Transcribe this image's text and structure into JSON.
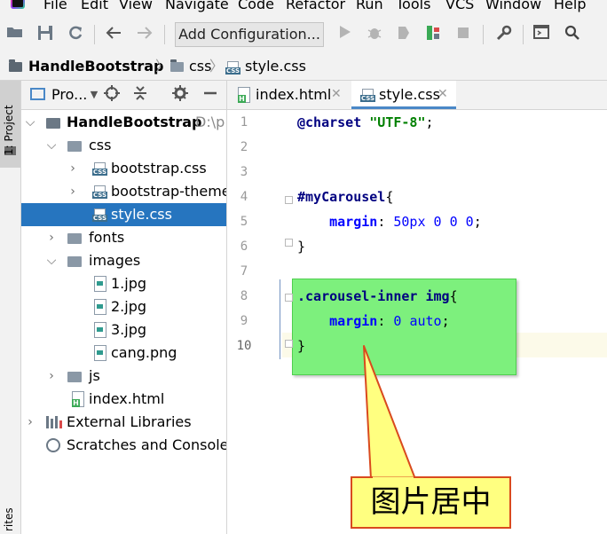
{
  "menu": {
    "items": [
      "File",
      "Edit",
      "View",
      "Navigate",
      "Code",
      "Refactor",
      "Run",
      "Tools",
      "VCS",
      "Window",
      "Help"
    ]
  },
  "toolbar": {
    "add_configuration_label": "Add Configuration..."
  },
  "breadcrumb": {
    "project": "HandleBootstrap",
    "folder": "css",
    "file": "style.css"
  },
  "left_stripe": {
    "project_tab": "1: Project",
    "bottom_tab": "rites"
  },
  "project_panel": {
    "title": "Pro...",
    "tree": [
      {
        "label": "HandleBootstrap",
        "hint": "D:\\p"
      },
      {
        "label": "css"
      },
      {
        "label": "bootstrap.css"
      },
      {
        "label": "bootstrap-theme"
      },
      {
        "label": "style.css"
      },
      {
        "label": "fonts"
      },
      {
        "label": "images"
      },
      {
        "label": "1.jpg"
      },
      {
        "label": "2.jpg"
      },
      {
        "label": "3.jpg"
      },
      {
        "label": "cang.png"
      },
      {
        "label": "js"
      },
      {
        "label": "index.html"
      },
      {
        "label": "External Libraries"
      },
      {
        "label": "Scratches and Consoles"
      }
    ]
  },
  "editor": {
    "tabs": [
      {
        "label": "index.html",
        "active": false
      },
      {
        "label": "style.css",
        "active": true
      }
    ],
    "line_numbers": [
      "1",
      "2",
      "3",
      "4",
      "5",
      "6",
      "7",
      "8",
      "9",
      "10"
    ],
    "code": {
      "l1_kw": "@charset",
      "l1_str": "\"UTF-8\"",
      "l1_end": ";",
      "l4_sel": "#myCarousel",
      "l4_brace": "{",
      "l5_prop": "margin",
      "l5_colon": ": ",
      "l5_val1": "50px",
      "l5_val2": "0",
      "l5_val3": "0",
      "l5_val4": "0",
      "l5_end": ";",
      "l6": "}",
      "l8_sel": ".carousel-inner img",
      "l8_brace": "{",
      "l9_prop": "margin",
      "l9_colon": ": ",
      "l9_val1": "0",
      "l9_val2": "auto",
      "l9_end": ";",
      "l10": "}"
    }
  },
  "annotation": {
    "callout_text": "图片居中",
    "highlight_color": "#7df07d",
    "callout_fill": "#ffff80",
    "callout_border": "#d94a1e"
  }
}
